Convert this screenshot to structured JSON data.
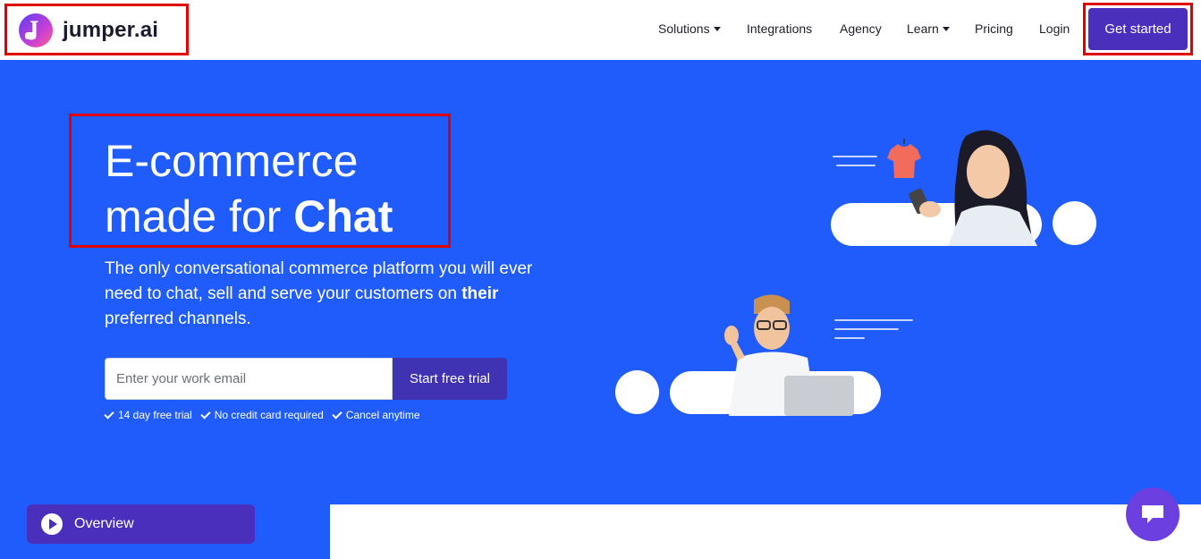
{
  "brand": {
    "name": "jumper.ai",
    "mark": "J"
  },
  "nav": {
    "items": [
      {
        "label": "Solutions",
        "dropdown": true
      },
      {
        "label": "Integrations",
        "dropdown": false
      },
      {
        "label": "Agency",
        "dropdown": false
      },
      {
        "label": "Learn",
        "dropdown": true
      },
      {
        "label": "Pricing",
        "dropdown": false
      },
      {
        "label": "Login",
        "dropdown": false
      }
    ],
    "cta": "Get started"
  },
  "hero": {
    "headline_line1": "E-commerce",
    "headline_line2": "made for",
    "headline_bold": "Chat",
    "sub_text": "The only conversational commerce platform you will ever need to chat, sell and serve your customers on",
    "sub_bold": "their",
    "sub_end": "preferred channels.",
    "email_placeholder": "Enter your work email",
    "trial_button": "Start free trial",
    "checks": [
      "14 day free trial",
      "No credit card required",
      "Cancel anytime"
    ]
  },
  "footer": {
    "overview_label": "Overview"
  },
  "colors": {
    "hero_bg": "#1f5cfb",
    "primary": "#4a2fbd",
    "highlight": "#e00000",
    "chat_fab": "#6b3fe0"
  },
  "icons": [
    "caret-down-icon",
    "check-icon",
    "play-icon",
    "chat-icon",
    "tshirt-icon"
  ]
}
